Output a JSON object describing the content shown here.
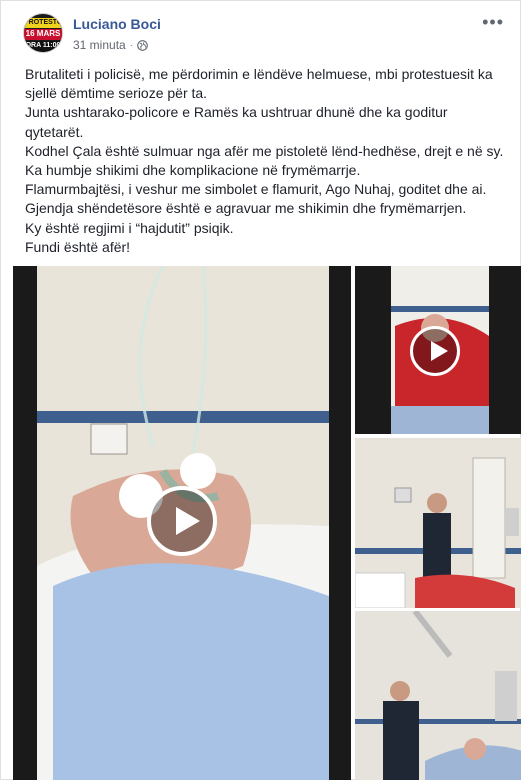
{
  "post": {
    "author": "Luciano Boci",
    "timestamp": "31 minuta",
    "privacy_icon": "globe-icon",
    "more_icon": "ellipsis-icon",
    "avatar_lines": [
      "PROTESTO",
      "16 MARS",
      "ORA 11:00"
    ],
    "text_lines": [
      "Brutaliteti i policisë, me përdorimin e lëndëve helmuese, mbi protestuesit ka",
      "sjellë dëmtime serioze për ta.",
      "Junta ushtarako-policore e Ramës ka ushtruar dhunë dhe ka goditur",
      "qytetarët.",
      "Kodhel Çala është sulmuar nga afër me pistoletë lënd-hedhëse, drejt e në sy.",
      "Ka humbje shikimi dhe komplikacione në frymëmarrje.",
      "Flamurmbajtësi, i veshur me simbolet e flamurit, Ago Nuhaj, goditet dhe ai.",
      "Gjendja shëndetësore është e agravuar me shikimin dhe frymëmarrjen.",
      "Ky është regjimi i “hajdutit” psiqik.",
      "Fundi është afër!"
    ],
    "media": [
      {
        "type": "video",
        "description": "man lying in hospital bed with oxygen mask",
        "play_icon": "play-icon"
      },
      {
        "type": "video",
        "description": "man in red jacket in hospital bed",
        "play_icon": "play-icon"
      },
      {
        "type": "photo",
        "description": "man in suit visiting patient in hospital room"
      },
      {
        "type": "photo",
        "description": "man in suit standing beside patient bed"
      }
    ]
  },
  "colors": {
    "author_link": "#385898",
    "meta_text": "#616770",
    "body_text": "#1d2129"
  }
}
